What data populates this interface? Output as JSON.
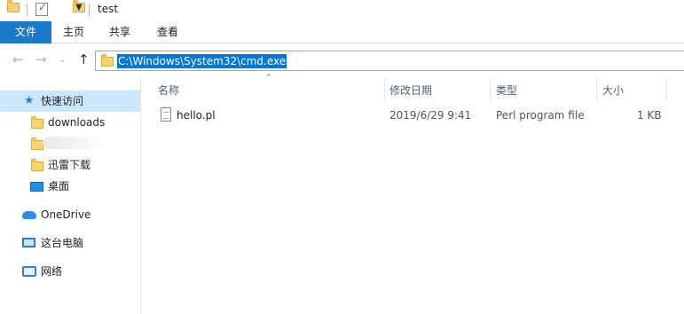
{
  "window": {
    "title": "test"
  },
  "ribbon": {
    "tabs": [
      "文件",
      "主页",
      "共享",
      "查看"
    ]
  },
  "address": {
    "path": "C:\\Windows\\System32\\cmd.exe"
  },
  "nav": {
    "back": "←",
    "forward": "→",
    "recent": "⌄",
    "up": "↑"
  },
  "sidebar": {
    "quick_access": "快速访问",
    "items": [
      "downloads",
      "",
      "迅雷下载",
      "桌面"
    ],
    "onedrive": "OneDrive",
    "this_pc": "这台电脑",
    "network": "网络"
  },
  "columns": {
    "name": "名称",
    "modified": "修改日期",
    "type": "类型",
    "size": "大小"
  },
  "files": [
    {
      "name": "hello.pl",
      "modified": "2019/6/29 9:41",
      "type": "Perl program file",
      "size": "1 KB"
    }
  ],
  "colors": {
    "accent": "#1979ca",
    "selection": "#0078d7",
    "nav_selected": "#cce8ff"
  }
}
